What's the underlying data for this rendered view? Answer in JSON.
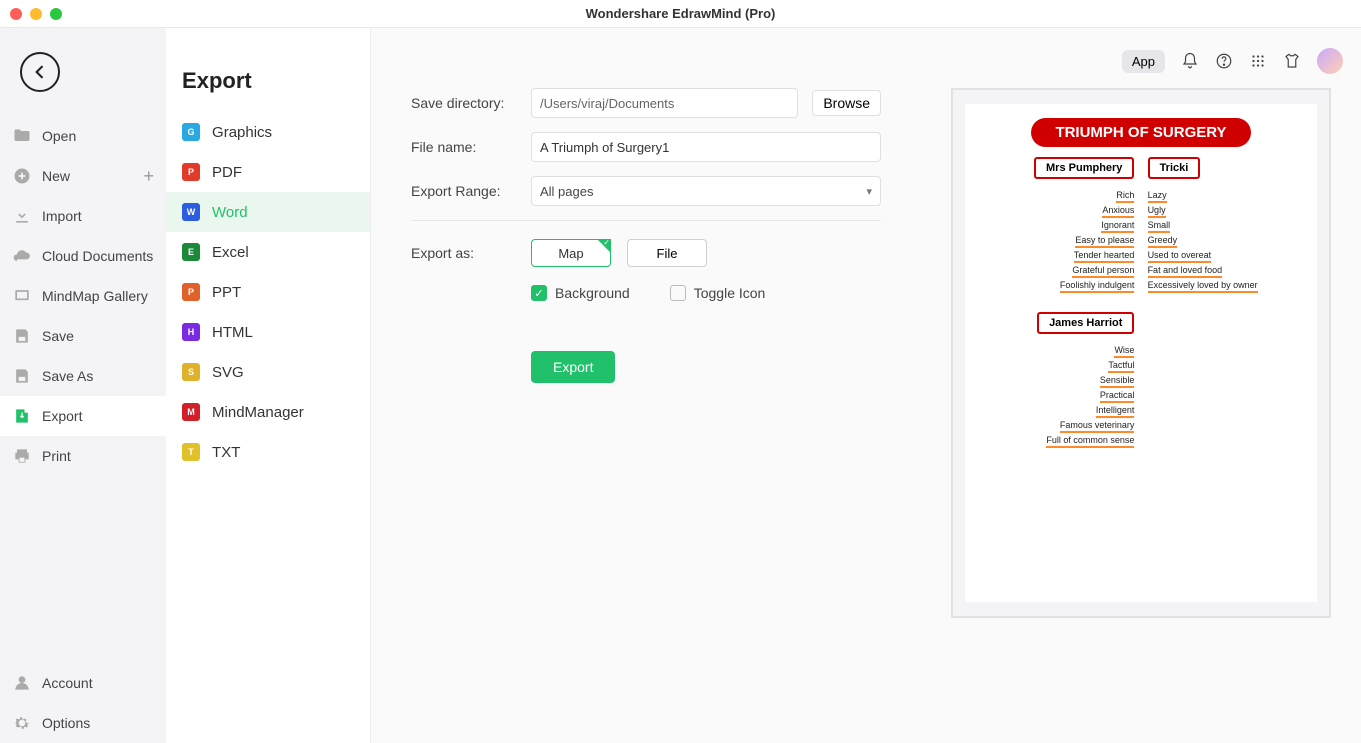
{
  "titlebar": {
    "title": "Wondershare EdrawMind (Pro)"
  },
  "sidebar1": {
    "items": [
      {
        "label": "Open",
        "icon": "folder"
      },
      {
        "label": "New",
        "icon": "plus-circle",
        "plus": true
      },
      {
        "label": "Import",
        "icon": "download"
      },
      {
        "label": "Cloud Documents",
        "icon": "cloud"
      },
      {
        "label": "MindMap Gallery",
        "icon": "grid"
      },
      {
        "label": "Save",
        "icon": "save"
      },
      {
        "label": "Save As",
        "icon": "save-as"
      },
      {
        "label": "Export",
        "icon": "export",
        "active": true
      },
      {
        "label": "Print",
        "icon": "printer"
      }
    ],
    "bottom": [
      {
        "label": "Account",
        "icon": "user"
      },
      {
        "label": "Options",
        "icon": "gear"
      }
    ]
  },
  "sidebar2": {
    "title": "Export",
    "items": [
      {
        "label": "Graphics",
        "color": "#2aa9e0"
      },
      {
        "label": "PDF",
        "color": "#e03a2a"
      },
      {
        "label": "Word",
        "color": "#2a5de0",
        "active": true
      },
      {
        "label": "Excel",
        "color": "#1a8a3a"
      },
      {
        "label": "PPT",
        "color": "#e0612a"
      },
      {
        "label": "HTML",
        "color": "#7a2ae0"
      },
      {
        "label": "SVG",
        "color": "#e0b12a"
      },
      {
        "label": "MindManager",
        "color": "#d1202a"
      },
      {
        "label": "TXT",
        "color": "#e0c12a"
      }
    ]
  },
  "form": {
    "saveDirLabel": "Save directory:",
    "saveDirValue": "/Users/viraj/Documents",
    "browse": "Browse",
    "fileNameLabel": "File name:",
    "fileNameValue": "A Triumph of Surgery1",
    "exportRangeLabel": "Export Range:",
    "exportRangeValue": "All pages",
    "exportAsLabel": "Export as:",
    "seg": {
      "map": "Map",
      "file": "File"
    },
    "chk": {
      "background": "Background",
      "toggle": "Toggle Icon"
    },
    "exportBtn": "Export"
  },
  "topright": {
    "app": "App"
  },
  "preview": {
    "title": "TRIUMPH OF SURGERY",
    "left1": {
      "head": "Mrs Pumphery",
      "leaves": [
        "Rich",
        "Anxious",
        "Ignorant",
        "Easy to please",
        "Tender hearted",
        "Grateful person",
        "Foolishly indulgent"
      ]
    },
    "right1": {
      "head": "Tricki",
      "leaves": [
        "Lazy",
        "Ugly",
        "Small",
        "Greedy",
        "Used to overeat",
        "Fat and loved food",
        "Excessively loved by owner"
      ]
    },
    "left2": {
      "head": "James Harriot",
      "leaves": [
        "Wise",
        "Tactful",
        "Sensible",
        "Practical",
        "Intelligent",
        "Famous veterinary",
        "Full of common sense"
      ]
    }
  }
}
